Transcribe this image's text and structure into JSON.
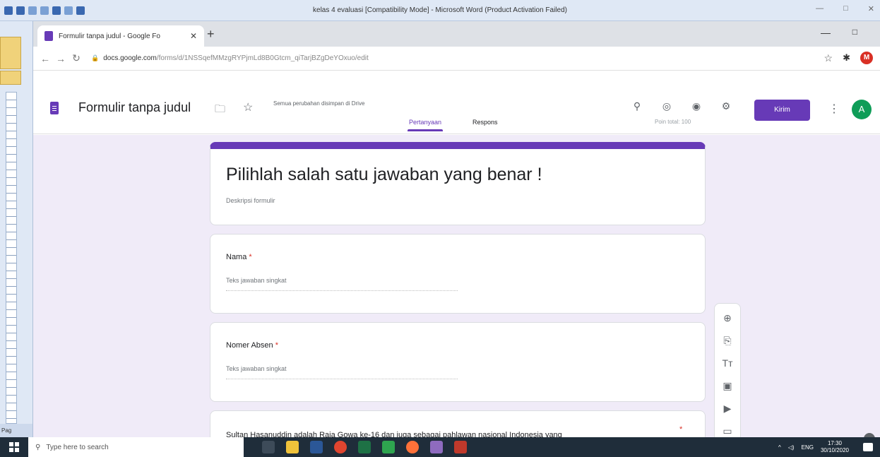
{
  "word": {
    "title": "kelas 4 evaluasi [Compatibility Mode] - Microsoft Word (Product Activation Failed)",
    "status_fragment": "Pag"
  },
  "browser": {
    "tab_title": "Formulir tanpa judul - Google Fo",
    "url_host": "docs.google.com",
    "url_path": "/forms/d/1NSSqefMMzgRYPjmLd8B0Gtcm_qiTarjBZgDeYOxuo/edit",
    "profile_initial": "M"
  },
  "forms": {
    "doc_name": "Formulir tanpa judul",
    "saved_note": "Semua perubahan disimpan di Drive",
    "send_label": "Kirim",
    "avatar_initial": "A",
    "tab_questions": "Pertanyaan",
    "tab_responses": "Respons",
    "total_points": "Poin total: 100",
    "title": "Pilihlah salah satu jawaban yang benar !",
    "description": "Deskripsi formulir",
    "questions": [
      {
        "label": "Nama",
        "required_mark": "*",
        "placeholder": "Teks jawaban singkat"
      },
      {
        "label": "Nomer Absen",
        "required_mark": "*",
        "placeholder": "Teks jawaban singkat"
      },
      {
        "label": "Sultan Hasanuddin adalah Raja Gowa ke-16 dan juga sebagai pahlawan nasional Indonesia yang",
        "required_mark": "*"
      }
    ]
  },
  "taskbar": {
    "search_placeholder": "Type here to search",
    "lang": "ENG",
    "time": "17:30",
    "date": "30/10/2020"
  },
  "colors": {
    "forms_purple": "#673ab7",
    "form_bg": "#f0ebf8"
  }
}
